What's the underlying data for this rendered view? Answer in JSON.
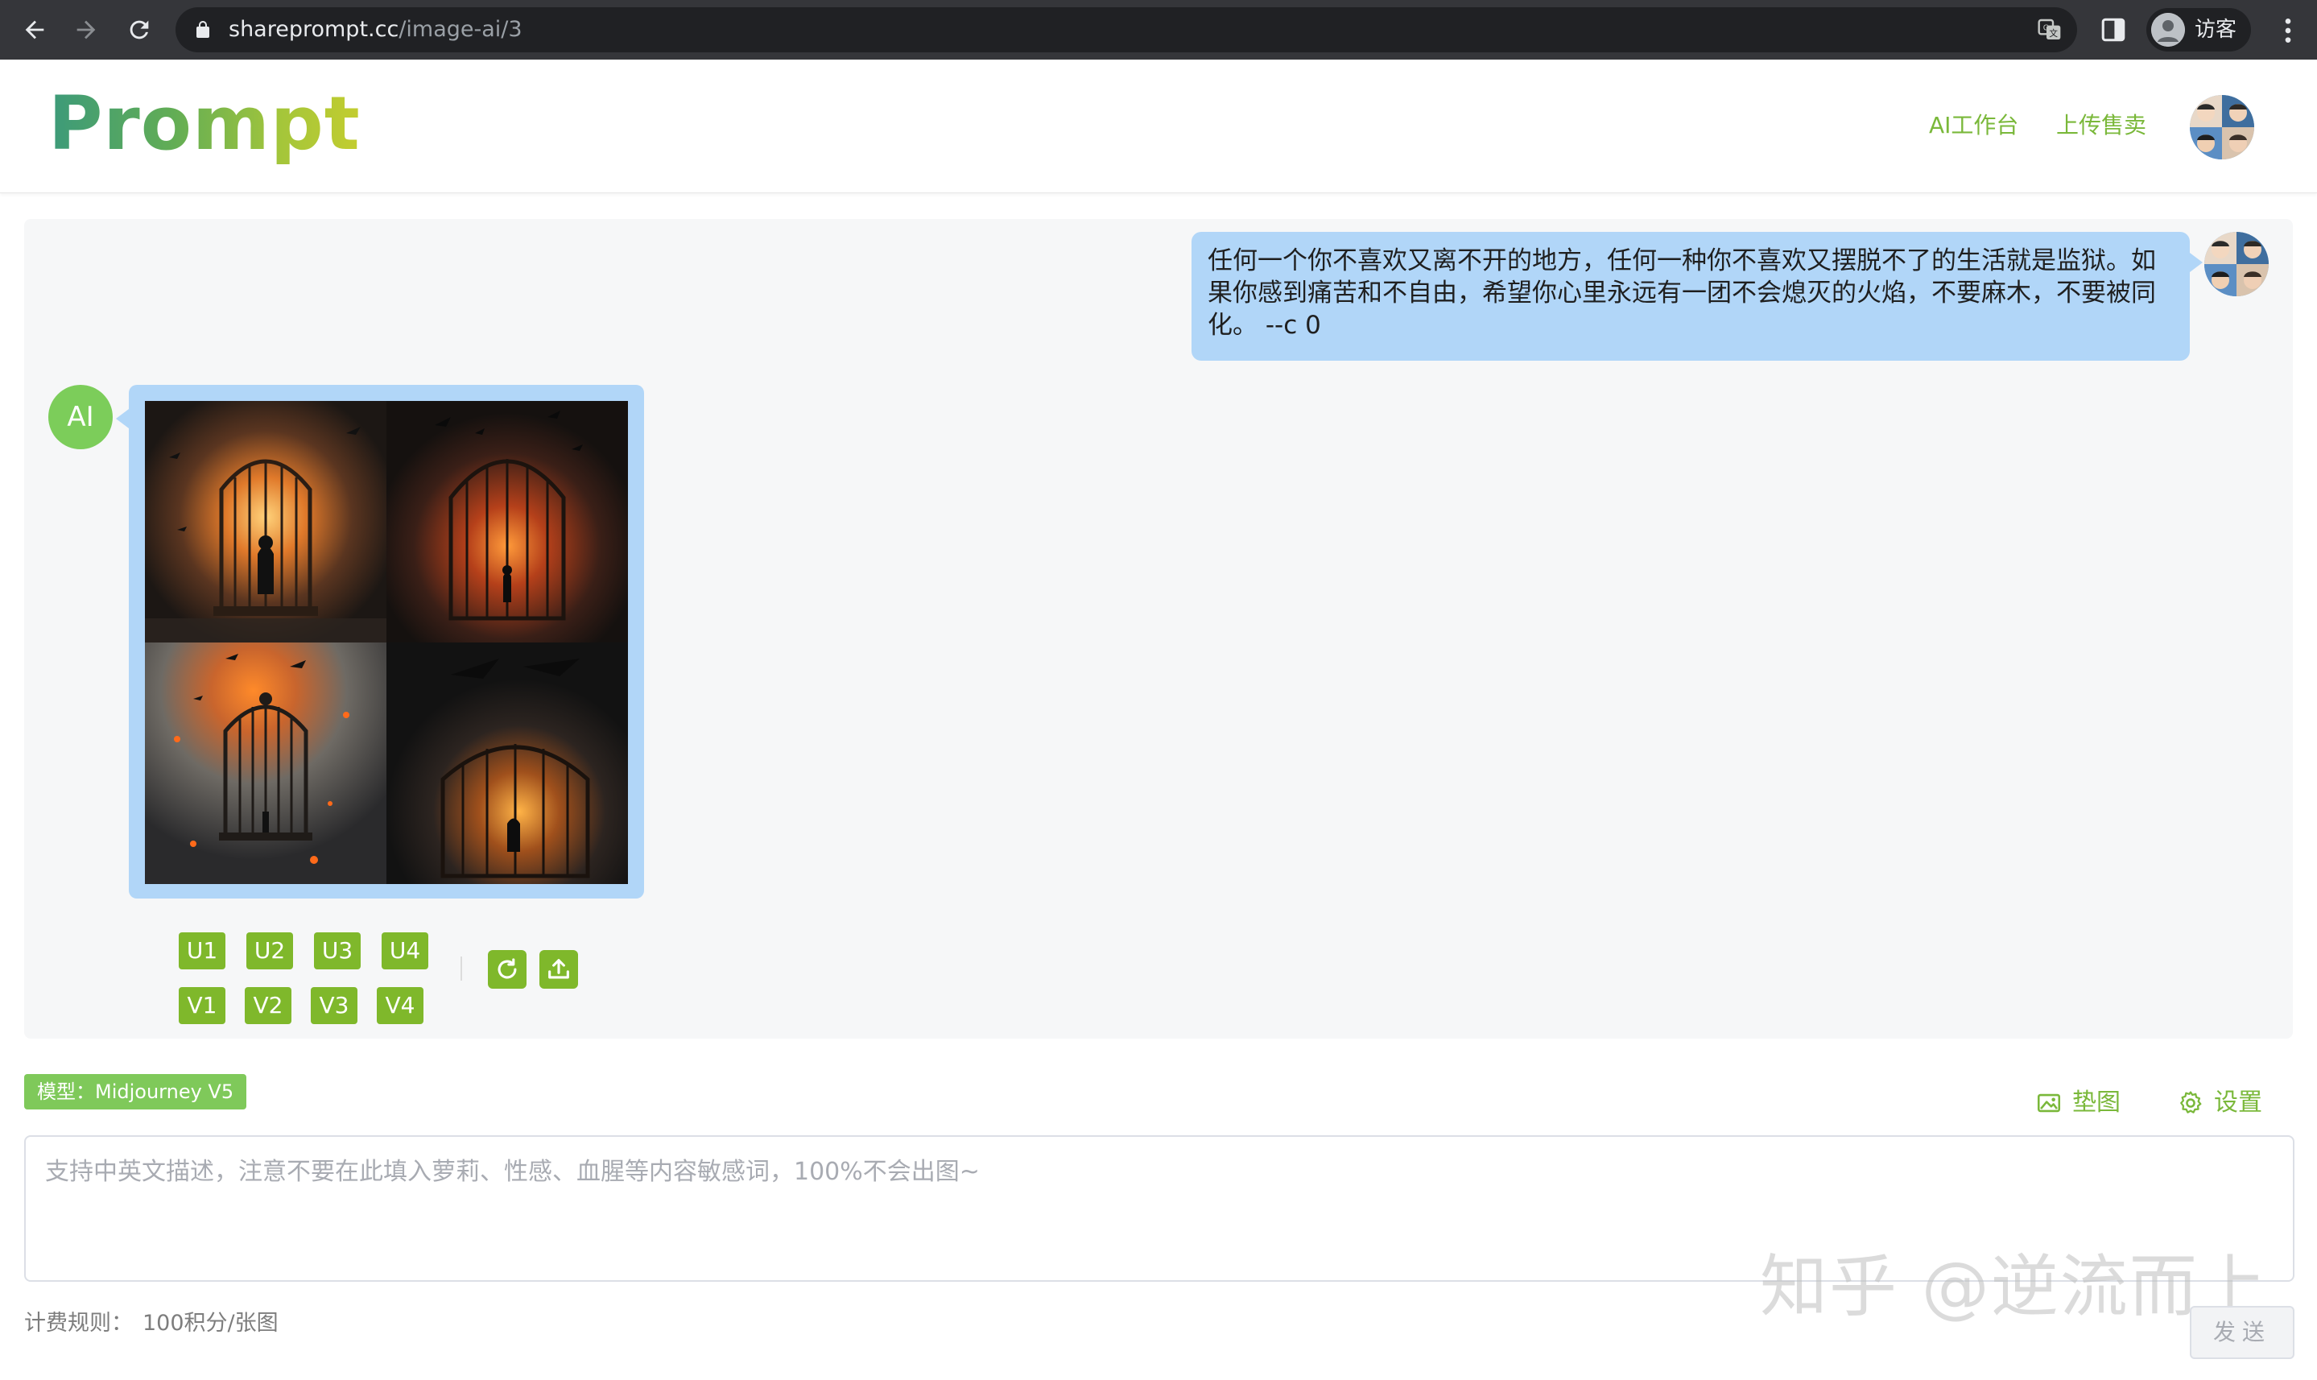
{
  "browser": {
    "url_host": "shareprompt.cc",
    "url_path": "/image-ai/3",
    "profile_label": "访客"
  },
  "header": {
    "logo": "Prompt",
    "nav": [
      {
        "label": "AI工作台"
      },
      {
        "label": "上传售卖"
      }
    ]
  },
  "chat": {
    "user_message": "任何一个你不喜欢又离不开的地方，任何一种你不喜欢又摆脱不了的生活就是监狱。如果你感到痛苦和不自由，希望你心里永远有一团不会熄灭的火焰，不要麻木，不要被同化。 --c 0",
    "ai_avatar_label": "AI",
    "upscale_buttons": [
      "U1",
      "U2",
      "U3",
      "U4"
    ],
    "variation_buttons": [
      "V1",
      "V2",
      "V3",
      "V4"
    ],
    "icons": [
      "refresh-icon",
      "upload-icon"
    ]
  },
  "composer": {
    "model_tag": "模型：Midjourney V5",
    "pad_image_label": "垫图",
    "settings_label": "设置",
    "placeholder": "支持中英文描述，注意不要在此填入萝莉、性感、血腥等内容敏感词，100%不会出图~",
    "value": "",
    "billing_label": "计费规则：",
    "billing_value": "100积分/张图",
    "send_label": "发送"
  },
  "watermark": "知乎 @逆流而上",
  "colors": {
    "accent": "#7fb82b",
    "bubble": "#b1d6f8",
    "ai_avatar": "#7ccd5a"
  }
}
